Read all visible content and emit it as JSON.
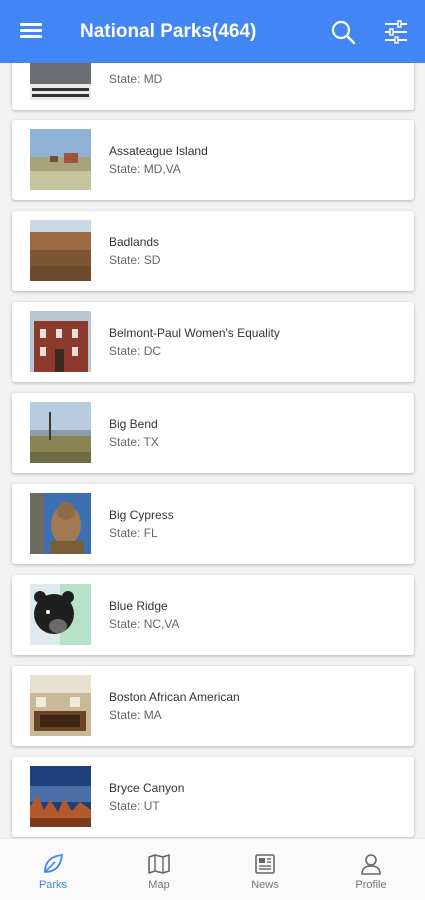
{
  "header": {
    "title": "National Parks(464)",
    "menu_icon": "menu-icon",
    "search_icon": "search-icon",
    "filter_icon": "tune-icon",
    "background": "#4285f4"
  },
  "parks": [
    {
      "name": "",
      "state": "State: MD"
    },
    {
      "name": "Assateague Island",
      "state": "State: MD,VA"
    },
    {
      "name": "Badlands",
      "state": "State: SD"
    },
    {
      "name": "Belmont-Paul Women's Equality",
      "state": "State: DC"
    },
    {
      "name": "Big Bend",
      "state": "State: TX"
    },
    {
      "name": "Big Cypress",
      "state": "State: FL"
    },
    {
      "name": "Blue Ridge",
      "state": "State: NC,VA"
    },
    {
      "name": "Boston African American",
      "state": "State: MA"
    },
    {
      "name": "Bryce Canyon",
      "state": "State: UT"
    }
  ],
  "bottom_nav": {
    "parks": "Parks",
    "map": "Map",
    "news": "News",
    "profile": "Profile",
    "active": "Parks",
    "active_color": "#4285f4"
  }
}
